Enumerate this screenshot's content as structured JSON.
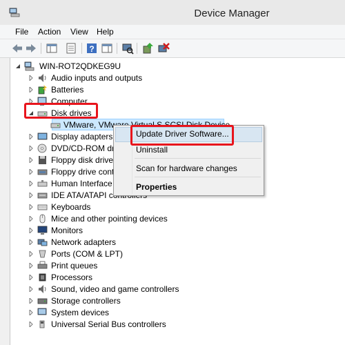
{
  "window": {
    "title": "Device Manager"
  },
  "menu": [
    "File",
    "Action",
    "View",
    "Help"
  ],
  "toolbar": [
    "back-icon",
    "forward-icon",
    "show-hide-console-tree-icon",
    "properties-icon",
    "help-icon",
    "action-pane-icon",
    "scan-hardware-icon",
    "update-driver-icon",
    "uninstall-device-icon"
  ],
  "tree": {
    "root": "WIN-ROT2QDKEG9U",
    "categories": [
      "Audio inputs and outputs",
      "Batteries",
      "Computer",
      "Disk drives",
      "Display adapters",
      "DVD/CD-ROM drives",
      "Floppy disk drives",
      "Floppy drive controllers",
      "Human Interface Devices",
      "IDE ATA/ATAPI controllers",
      "Keyboards",
      "Mice and other pointing devices",
      "Monitors",
      "Network adapters",
      "Ports (COM & LPT)",
      "Print queues",
      "Processors",
      "Sound, video and game controllers",
      "Storage controllers",
      "System devices",
      "Universal Serial Bus controllers"
    ],
    "disk_child": "VMware, VMware Virtual S SCSI Disk Device"
  },
  "context_menu": {
    "update": "Update Driver Software...",
    "uninstall": "Uninstall",
    "scan": "Scan for hardware changes",
    "properties": "Properties"
  },
  "colors": {
    "highlight_box": "#e8141c",
    "selection": "#cce8ff"
  }
}
